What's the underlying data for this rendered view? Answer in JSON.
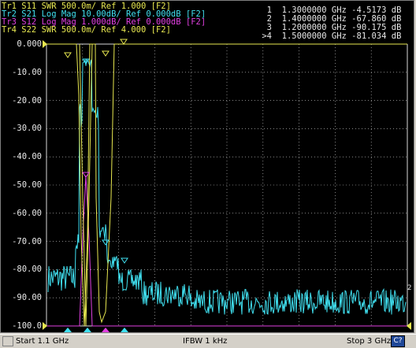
{
  "traces": [
    {
      "text": "Tr1 S11 SWR 500.0m/ Ref 1.000 [F2]",
      "color": "#e8e850"
    },
    {
      "text": "Tr2 S21 Log Mag 10.00dB/ Ref 0.000dB [F2]",
      "color": "#40e0f0",
      "active": true
    },
    {
      "text": "Tr3 S12 Log Mag 1.000dB/ Ref 0.000dB [F2]",
      "color": "#e040e0"
    },
    {
      "text": "Tr4 S22 SWR 500.0m/ Ref 4.000 [F2]",
      "color": "#e8e850"
    }
  ],
  "markers": [
    {
      "id": "1",
      "freq": "1.3000000 GHz",
      "value": "-4.5173 dB"
    },
    {
      "id": "2",
      "freq": "1.4000000 GHz",
      "value": "-67.860 dB"
    },
    {
      "id": "3",
      "freq": "1.2000000 GHz",
      "value": "-90.175 dB"
    },
    {
      "id": ">4",
      "freq": "1.5000000 GHz",
      "value": "-81.034 dB"
    }
  ],
  "y_axis": {
    "labels": [
      "0.000",
      "-10.00",
      "-20.00",
      "-30.00",
      "-40.00",
      "-50.00",
      "-60.00",
      "-70.00",
      "-80.00",
      "-90.00",
      "-100.0"
    ],
    "min": -100,
    "max": 0
  },
  "right_channel_marker": "2",
  "status": {
    "start": "Start 1.1 GHz",
    "ifbw": "IFBW 1 kHz",
    "stop": "Stop 3 GHz",
    "channel_badge": "C?"
  },
  "colors": {
    "grid": "#e8e8e8",
    "tr1": "#e8e850",
    "tr2": "#40e0f0",
    "tr3": "#e040e0"
  }
}
